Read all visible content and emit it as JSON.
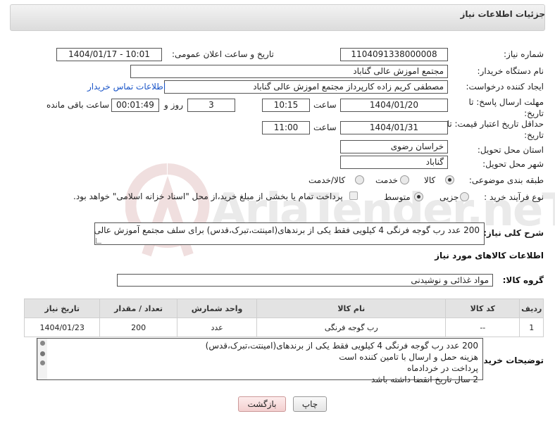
{
  "header": {
    "title": "جزئیات اطلاعات نیاز"
  },
  "labels": {
    "need_number": "شماره نیاز:",
    "announce_datetime": "تاریخ و ساعت اعلان عمومی:",
    "buyer_org": "نام دستگاه خریدار:",
    "requester": "ایجاد کننده درخواست:",
    "buyer_contact": "اطلاعات تماس خریدار",
    "reply_deadline": "مهلت ارسال پاسخ: تا تاریخ:",
    "price_validity": "حداقل تاریخ اعتبار قیمت: تا تاریخ:",
    "hour": "ساعت",
    "day_and": "روز و",
    "remaining": "ساعت باقی مانده",
    "province": "استان محل تحویل:",
    "city": "شهر محل تحویل:",
    "category": "طبقه بندی موضوعی:",
    "process_type": "نوع فرآیند خرید :",
    "general_desc": "شرح کلی نیاز:",
    "goods_info": "اطلاعات کالاهای مورد نیاز",
    "goods_group": "گروه کالا:",
    "buyer_notes": "توضیحات خریدار:"
  },
  "values": {
    "need_number": "1104091338000008",
    "announce_datetime": "1404/01/17 - 10:01",
    "buyer_org": "مجتمع اموزش عالی گناباد",
    "requester": "مصطفی کریم زاده کارپرداز مجتمع اموزش عالی گناباد",
    "reply_date": "1404/01/20",
    "reply_time": "10:15",
    "reply_days": "3",
    "reply_remaining": "00:01:49",
    "validity_date": "1404/01/31",
    "validity_time": "11:00",
    "province": "خراسان رضوی",
    "city": "گناباد",
    "general_desc": "200  عدد رب گوجه فرنگی 4 کیلویی فقط یکی از برندهای(امینتت،تبرک،قدس) برای سلف مجتمع آموزش عالی",
    "goods_group": "مواد غذائی و نوشیدنی"
  },
  "category_options": {
    "goods": "کالا",
    "service": "خدمت",
    "goods_service": "کالا/خدمت",
    "selected": "کالا"
  },
  "process_options": {
    "small": "جزیی",
    "medium": "متوسط",
    "selected": "متوسط",
    "payment_note": "پرداخت تمام یا بخشی از مبلغ خرید،از محل \"اسناد خزانه اسلامی\" خواهد بود."
  },
  "table": {
    "headers": [
      "ردیف",
      "کد کالا",
      "نام کالا",
      "واحد شمارش",
      "تعداد / مقدار",
      "تاریخ نیاز"
    ],
    "rows": [
      [
        "1",
        "--",
        "رب گوجه فرنگی",
        "عدد",
        "200",
        "1404/01/23"
      ]
    ]
  },
  "buyer_notes": [
    "200  عدد رب گوجه فرنگی 4 کیلویی فقط یکی از برندهای(امینتت،تبرک،قدس)",
    "هزینه حمل و ارسال با تامین کننده است",
    "پرداخت در خردادماه",
    "2 سال تاریخ انقضا داشته باشد"
  ],
  "buttons": {
    "print": "چاپ",
    "back": "بازگشت"
  },
  "watermark": "AriaTender.neT"
}
